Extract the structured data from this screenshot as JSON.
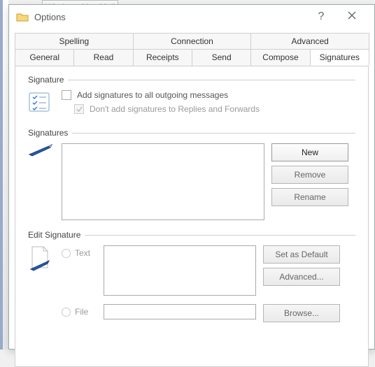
{
  "bg_hint": "Windows Live Mail",
  "window": {
    "title": "Options"
  },
  "tabs_row1": [
    "Spelling",
    "Connection",
    "Advanced"
  ],
  "tabs_row2": [
    "General",
    "Read",
    "Receipts",
    "Send",
    "Compose",
    "Signatures"
  ],
  "active_tab": "Signatures",
  "group_signature": {
    "title": "Signature",
    "cb1": "Add signatures to all outgoing messages",
    "cb2": "Don't add signatures to Replies and Forwards"
  },
  "group_signatures": {
    "title": "Signatures",
    "btn_new": "New",
    "btn_remove": "Remove",
    "btn_rename": "Rename"
  },
  "group_edit": {
    "title": "Edit Signature",
    "radio_text": "Text",
    "radio_file": "File",
    "btn_default": "Set as Default",
    "btn_advanced": "Advanced...",
    "btn_browse": "Browse..."
  }
}
